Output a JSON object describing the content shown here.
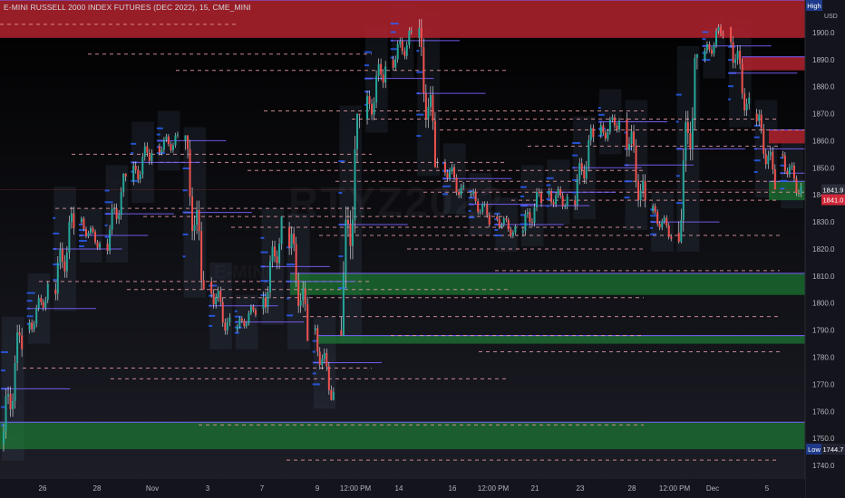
{
  "header": {
    "title": "E-MINI RUSSELL 2000 INDEX FUTURES (DEC 2022), 15, CME_MINI"
  },
  "watermark": {
    "symbol": "RTYZ2022",
    "sub": "E-MINI"
  },
  "colors": {
    "background_top": "#000000",
    "background_bottom": "#1c1d26",
    "bull": "#26a69a",
    "bear": "#ef5350",
    "supply_zone": "#b2222e",
    "demand_zone": "#1d7a33",
    "level_line": "#e89aa4",
    "poc_line": "#7b61ff",
    "volume_profile": "#2962ff",
    "axis_text": "#b2b5be"
  },
  "chart_data": {
    "type": "candlestick",
    "title": "E-MINI RUSSELL 2000 INDEX FUTURES (DEC 2022), 15, CME_MINI",
    "ylabel": "USD",
    "ylim": [
      1735,
      1912
    ],
    "y_ticks": [
      1740.0,
      1750.0,
      1760.0,
      1770.0,
      1780.0,
      1790.0,
      1800.0,
      1810.0,
      1820.0,
      1830.0,
      1840.0,
      1850.0,
      1860.0,
      1870.0,
      1880.0,
      1890.0,
      1900.0
    ],
    "x_ticks": [
      "26",
      "28",
      "Nov",
      "3",
      "7",
      "9",
      "12:00 PM",
      "14",
      "16",
      "12:00 PM",
      "21",
      "23",
      "28",
      "12:00 PM",
      "Dec",
      "5"
    ],
    "price_markers": {
      "high": {
        "label": "High",
        "value": 1908.0
      },
      "low": {
        "label": "Low",
        "value": "1744.7"
      },
      "current": "1841.0",
      "prev": "1841.9"
    },
    "zones": [
      {
        "kind": "supply",
        "top": 1912,
        "bottom": 1898
      },
      {
        "kind": "supply",
        "top": 1891,
        "bottom": 1886
      },
      {
        "kind": "supply",
        "top": 1864,
        "bottom": 1859
      },
      {
        "kind": "demand",
        "top": 1845,
        "bottom": 1838
      },
      {
        "kind": "demand",
        "top": 1811,
        "bottom": 1803
      },
      {
        "kind": "demand",
        "top": 1788,
        "bottom": 1785
      },
      {
        "kind": "demand",
        "top": 1756,
        "bottom": 1746
      }
    ],
    "level_lines": [
      1903,
      1892,
      1886,
      1871,
      1868,
      1864,
      1858,
      1855,
      1852,
      1849,
      1845,
      1841,
      1838,
      1835,
      1832,
      1828,
      1825,
      1820,
      1812,
      1808,
      1805,
      1802,
      1795,
      1788,
      1782,
      1776,
      1772,
      1755,
      1742
    ],
    "series": [
      {
        "name": "RTYZ2022",
        "x": [
          "Oct 24",
          "Oct 25",
          "Oct 26",
          "Oct 27",
          "Oct 28",
          "Oct 31",
          "Nov 1",
          "Nov 2",
          "Nov 3",
          "Nov 4",
          "Nov 7",
          "Nov 8",
          "Nov 9",
          "Nov 10",
          "Nov 11",
          "Nov 14",
          "Nov 15",
          "Nov 16",
          "Nov 17",
          "Nov 18",
          "Nov 21",
          "Nov 22",
          "Nov 23",
          "Nov 25",
          "Nov 28",
          "Nov 29",
          "Nov 30",
          "Dec 1",
          "Dec 2",
          "Dec 5",
          "Dec 6"
        ],
        "open": [
          1748,
          1790,
          1805,
          1830,
          1822,
          1845,
          1858,
          1860,
          1808,
          1790,
          1798,
          1828,
          1790,
          1790,
          1868,
          1890,
          1898,
          1852,
          1840,
          1832,
          1826,
          1840,
          1838,
          1862,
          1868,
          1834,
          1826,
          1890,
          1902,
          1870,
          1855
        ],
        "close": [
          1790,
          1805,
          1830,
          1822,
          1845,
          1858,
          1860,
          1808,
          1790,
          1798,
          1828,
          1790,
          1766,
          1868,
          1890,
          1898,
          1852,
          1840,
          1832,
          1826,
          1840,
          1838,
          1862,
          1868,
          1834,
          1826,
          1890,
          1902,
          1870,
          1845,
          1841
        ],
        "high": [
          1792,
          1808,
          1840,
          1832,
          1848,
          1864,
          1868,
          1862,
          1812,
          1800,
          1832,
          1830,
          1792,
          1870,
          1900,
          1908,
          1905,
          1856,
          1845,
          1836,
          1848,
          1850,
          1866,
          1876,
          1872,
          1838,
          1892,
          1904,
          1902,
          1872,
          1858
        ],
        "low": [
          1744.7,
          1788,
          1800,
          1818,
          1818,
          1840,
          1852,
          1805,
          1786,
          1786,
          1795,
          1786,
          1764,
          1788,
          1866,
          1886,
          1850,
          1836,
          1828,
          1822,
          1824,
          1832,
          1834,
          1858,
          1830,
          1822,
          1822,
          1886,
          1868,
          1842,
          1838
        ]
      }
    ]
  }
}
